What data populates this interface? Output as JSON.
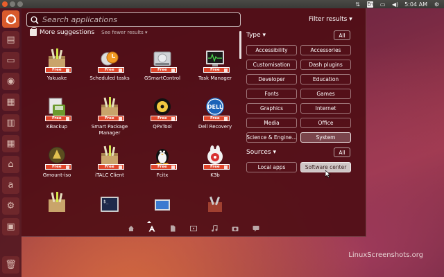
{
  "top_panel": {
    "language": "En",
    "time": "5:04 AM"
  },
  "launcher": {
    "items": [
      "dash-home",
      "files",
      "terminal",
      "firefox",
      "files-2",
      "document",
      "software-center",
      "amazon",
      "settings",
      "workspaces",
      "trash"
    ]
  },
  "dash": {
    "search_placeholder": "Search applications",
    "filter_results_label": "Filter results",
    "category": {
      "title": "More suggestions",
      "toggle": "See fewer results"
    },
    "apps": [
      {
        "name": "Yakuake",
        "badge": "Free",
        "icon": "package-icon"
      },
      {
        "name": "Scheduled tasks",
        "badge": "Free",
        "icon": "clock-icon"
      },
      {
        "name": "GSmartControl",
        "badge": "Free",
        "icon": "harddisk-icon"
      },
      {
        "name": "Task Manager",
        "badge": "Free",
        "icon": "monitor-icon"
      },
      {
        "name": "KBackup",
        "badge": "Free",
        "icon": "backup-icon"
      },
      {
        "name": "Smart Package Manager",
        "badge": "Free",
        "icon": "package-icon"
      },
      {
        "name": "QPxTool",
        "badge": "Free",
        "icon": "disc-icon"
      },
      {
        "name": "Dell Recovery",
        "badge": "Free",
        "icon": "dell-icon"
      },
      {
        "name": "Gmount-iso",
        "badge": "Free",
        "icon": "mount-icon"
      },
      {
        "name": "iTALC Client",
        "badge": "Free",
        "icon": "package-icon"
      },
      {
        "name": "Fcitx",
        "badge": "Free",
        "icon": "penguin-icon"
      },
      {
        "name": "K3b",
        "badge": "Free",
        "icon": "k3b-icon"
      }
    ],
    "partial_apps": [
      "package-icon",
      "terminal-icon",
      "laptop-icon",
      "tools-icon"
    ]
  },
  "filters": {
    "type": {
      "title": "Type",
      "all_label": "All",
      "options": [
        "Accessibility",
        "Accessories",
        "Customisation",
        "Dash plugins",
        "Developer",
        "Education",
        "Fonts",
        "Games",
        "Graphics",
        "Internet",
        "Media",
        "Office",
        "Science & Engine...",
        "System"
      ],
      "selected": "System"
    },
    "sources": {
      "title": "Sources",
      "all_label": "All",
      "options": [
        "Local apps",
        "Software center"
      ],
      "selected": "Software center"
    }
  },
  "lenses": [
    "home-lens",
    "applications-lens",
    "files-lens",
    "video-lens",
    "music-lens",
    "photos-lens",
    "social-lens"
  ],
  "watermark": "LinuxScreenshots.org"
}
